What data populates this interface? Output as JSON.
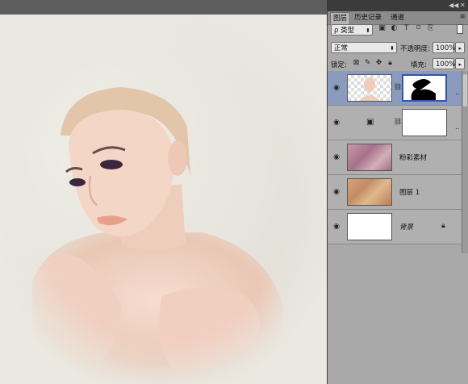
{
  "panel": {
    "tabs": [
      "图层",
      "历史记录",
      "通道"
    ],
    "filter_kind": "ρ 类型",
    "blend_mode": "正常",
    "opacity_label": "不透明度:",
    "opacity_value": "100%",
    "lock_label": "锁定:",
    "fill_label": "填充:",
    "fill_value": "100%",
    "more": ".."
  },
  "layers": [
    {
      "name": "",
      "selected": true
    },
    {
      "name": "",
      "selected": false
    },
    {
      "name": "粉彩素材",
      "selected": false
    },
    {
      "name": "图层 1",
      "selected": false
    },
    {
      "name": "背景",
      "selected": false,
      "locked": true
    }
  ],
  "colors": {
    "selected_row": "#8a9bbd",
    "panel_bg": "#a9a9a9"
  }
}
